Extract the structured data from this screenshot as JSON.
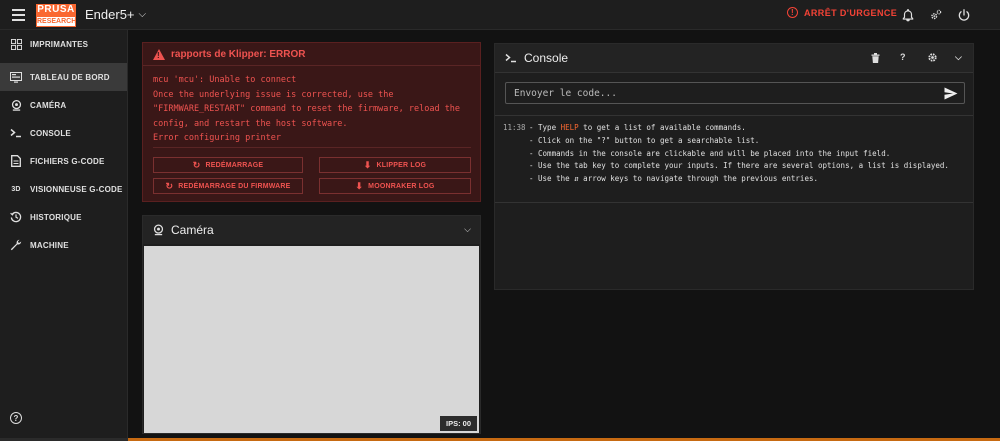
{
  "app": {
    "logo_top": "PRUSA",
    "logo_bottom": "RESEARCH",
    "printer_name": "Ender5+",
    "emergency_stop": "ARRÊT D'URGENCE"
  },
  "sidebar": {
    "items": [
      {
        "label": "IMPRIMANTES",
        "icon": "printers-grid-icon"
      },
      {
        "label": "TABLEAU DE BORD",
        "icon": "dashboard-icon",
        "active": true
      },
      {
        "label": "CAMÉRA",
        "icon": "webcam-icon"
      },
      {
        "label": "CONSOLE",
        "icon": "console-icon"
      },
      {
        "label": "FICHIERS G-CODE",
        "icon": "file-icon"
      },
      {
        "label": "VISIONNEUSE G-CODE",
        "icon": "3d-icon"
      },
      {
        "label": "HISTORIQUE",
        "icon": "history-icon"
      },
      {
        "label": "MACHINE",
        "icon": "wrench-icon"
      }
    ],
    "icon_3d_text": "3D"
  },
  "error": {
    "title": "rapports de Klipper: ERROR",
    "message": "mcu 'mcu': Unable to connect\nOnce the underlying issue is corrected, use the\n\"FIRMWARE_RESTART\" command to reset the firmware, reload the\nconfig, and restart the host software.\nError configuring printer",
    "buttons": {
      "restart": "REDÉMARRAGE",
      "klipper_log": "KLIPPER LOG",
      "firmware_restart": "REDÉMARRAGE DU FIRMWARE",
      "moonraker_log": "MOONRAKER LOG"
    }
  },
  "camera": {
    "title": "Caméra",
    "fps": "IPS: 00"
  },
  "console": {
    "title": "Console",
    "placeholder": "Envoyer le code...",
    "help_button": "?",
    "log": [
      {
        "time": "11:38",
        "pre": "- Type ",
        "kw": "HELP",
        "post": " to get a list of available commands."
      },
      {
        "time": "",
        "pre": "- Click on the \"?\" button to get a searchable list.",
        "kw": "",
        "post": ""
      },
      {
        "time": "",
        "pre": "- Commands in the console are clickable and will be placed into the input field.",
        "kw": "",
        "post": ""
      },
      {
        "time": "",
        "pre": "- Use the tab key to complete your inputs. If there are several options, a list is displayed.",
        "kw": "",
        "post": ""
      },
      {
        "time": "",
        "pre": "- Use the ⇵ arrow keys to navigate through the previous entries.",
        "kw": "",
        "post": ""
      }
    ]
  },
  "colors": {
    "accent": "#fa6831",
    "error": "#ef5350",
    "emergency": "#f44336"
  }
}
